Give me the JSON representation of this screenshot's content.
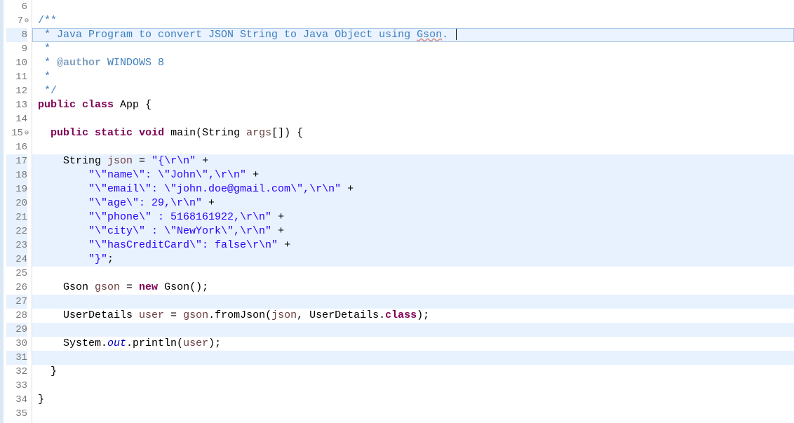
{
  "gutter": {
    "start": 6,
    "end": 35,
    "highlighted": [
      8,
      17,
      18,
      19,
      20,
      21,
      22,
      23,
      24,
      27,
      29,
      31
    ],
    "current": 8,
    "fold_markers": [
      7,
      15
    ]
  },
  "tokens": {
    "l7": [
      {
        "t": "/**",
        "c": "c-comment"
      }
    ],
    "l8": [
      {
        "t": " * Java Program to convert JSON String to Java Object using ",
        "c": "c-comment"
      },
      {
        "t": "Gson",
        "c": "c-comment spell"
      },
      {
        "t": ". ",
        "c": "c-comment"
      }
    ],
    "l9": [
      {
        "t": " *",
        "c": "c-comment"
      }
    ],
    "l10": [
      {
        "t": " * ",
        "c": "c-comment"
      },
      {
        "t": "@author",
        "c": "c-doctag"
      },
      {
        "t": " WINDOWS 8",
        "c": "c-comment"
      }
    ],
    "l11": [
      {
        "t": " *",
        "c": "c-comment"
      }
    ],
    "l12": [
      {
        "t": " */",
        "c": "c-comment"
      }
    ],
    "l13": [
      {
        "t": "public",
        "c": "c-kw"
      },
      {
        "t": " "
      },
      {
        "t": "class",
        "c": "c-kw"
      },
      {
        "t": " App {"
      }
    ],
    "l15": [
      {
        "t": "  "
      },
      {
        "t": "public",
        "c": "c-kw"
      },
      {
        "t": " "
      },
      {
        "t": "static",
        "c": "c-kw"
      },
      {
        "t": " "
      },
      {
        "t": "void",
        "c": "c-kw"
      },
      {
        "t": " main(String "
      },
      {
        "t": "args",
        "c": "c-var"
      },
      {
        "t": "[]) {"
      }
    ],
    "l17": [
      {
        "t": "    String "
      },
      {
        "t": "json",
        "c": "c-var"
      },
      {
        "t": " = "
      },
      {
        "t": "\"{\\r\\n\"",
        "c": "c-str"
      },
      {
        "t": " +"
      }
    ],
    "l18": [
      {
        "t": "        "
      },
      {
        "t": "\"\\\"name\\\": \\\"John\\\",\\r\\n\"",
        "c": "c-str"
      },
      {
        "t": " +"
      }
    ],
    "l19": [
      {
        "t": "        "
      },
      {
        "t": "\"\\\"email\\\": \\\"john.doe@gmail.com\\\",\\r\\n\"",
        "c": "c-str"
      },
      {
        "t": " +"
      }
    ],
    "l20": [
      {
        "t": "        "
      },
      {
        "t": "\"\\\"age\\\": 29,\\r\\n\"",
        "c": "c-str"
      },
      {
        "t": " +"
      }
    ],
    "l21": [
      {
        "t": "        "
      },
      {
        "t": "\"\\\"phone\\\" : 5168161922,\\r\\n\"",
        "c": "c-str"
      },
      {
        "t": " +"
      }
    ],
    "l22": [
      {
        "t": "        "
      },
      {
        "t": "\"\\\"city\\\" : \\\"NewYork\\\",\\r\\n\"",
        "c": "c-str"
      },
      {
        "t": " +"
      }
    ],
    "l23": [
      {
        "t": "        "
      },
      {
        "t": "\"\\\"hasCreditCard\\\": false\\r\\n\"",
        "c": "c-str"
      },
      {
        "t": " +"
      }
    ],
    "l24": [
      {
        "t": "        "
      },
      {
        "t": "\"}\"",
        "c": "c-str"
      },
      {
        "t": ";"
      }
    ],
    "l26": [
      {
        "t": "    Gson "
      },
      {
        "t": "gson",
        "c": "c-var"
      },
      {
        "t": " = "
      },
      {
        "t": "new",
        "c": "c-kw"
      },
      {
        "t": " Gson();"
      }
    ],
    "l28": [
      {
        "t": "    UserDetails "
      },
      {
        "t": "user",
        "c": "c-var"
      },
      {
        "t": " = "
      },
      {
        "t": "gson",
        "c": "c-var"
      },
      {
        "t": ".fromJson("
      },
      {
        "t": "json",
        "c": "c-var"
      },
      {
        "t": ", UserDetails."
      },
      {
        "t": "class",
        "c": "c-kw"
      },
      {
        "t": ");"
      }
    ],
    "l30": [
      {
        "t": "    System."
      },
      {
        "t": "out",
        "c": "c-field"
      },
      {
        "t": ".println("
      },
      {
        "t": "user",
        "c": "c-var"
      },
      {
        "t": ");"
      }
    ],
    "l32": [
      {
        "t": "  }"
      }
    ],
    "l34": [
      {
        "t": "}"
      }
    ]
  }
}
